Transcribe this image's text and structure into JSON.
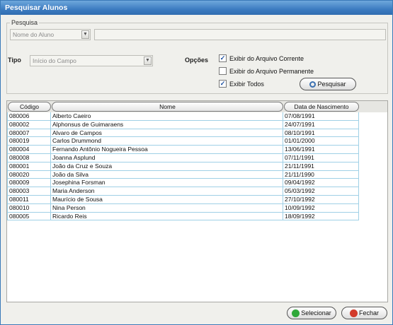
{
  "window": {
    "title": "Pesquisar Alunos"
  },
  "search": {
    "legend": "Pesquisa",
    "field_combo": "Nome do Aluno",
    "query_value": "",
    "tipo_label": "Tipo",
    "tipo_combo": "Início do Campo",
    "opcoes_label": "Opções",
    "options": [
      {
        "label": "Exibir do Arquivo Corrente",
        "checked": true
      },
      {
        "label": "Exibir do Arquivo Permanente",
        "checked": false
      },
      {
        "label": "Exibir Todos",
        "checked": true
      }
    ],
    "search_button": "Pesquisar"
  },
  "table": {
    "columns": [
      "Código",
      "Nome",
      "Data de Nascimento"
    ],
    "rows": [
      [
        "080006",
        "Alberto Caeiro",
        "07/08/1991"
      ],
      [
        "080002",
        "Alphonsus de Guimaraens",
        "24/07/1991"
      ],
      [
        "080007",
        "Alvaro de Campos",
        "08/10/1991"
      ],
      [
        "080019",
        "Carlos Drummond",
        "01/01/2000"
      ],
      [
        "080004",
        "Fernando Antônio Nogueira Pessoa",
        "13/06/1991"
      ],
      [
        "080008",
        "Joanna Asplund",
        "07/11/1991"
      ],
      [
        "080001",
        "João da Cruz e Souza",
        "21/11/1991"
      ],
      [
        "080020",
        "João da Silva",
        "21/11/1990"
      ],
      [
        "080009",
        "Josephina Forsman",
        "09/04/1992"
      ],
      [
        "080003",
        "Maria Anderson",
        "05/03/1992"
      ],
      [
        "080011",
        "Maurício de Sousa",
        "27/10/1992"
      ],
      [
        "080010",
        "Nina Person",
        "10/09/1992"
      ],
      [
        "080005",
        "Ricardo Reis",
        "18/09/1992"
      ]
    ]
  },
  "footer": {
    "select_button": "Selecionar",
    "close_button": "Fechar"
  },
  "colors": {
    "title_bar": "#3d7cc1",
    "grid_line": "#9fd0e6",
    "select_icon": "#2fa83a",
    "close_icon": "#d23a2a"
  }
}
